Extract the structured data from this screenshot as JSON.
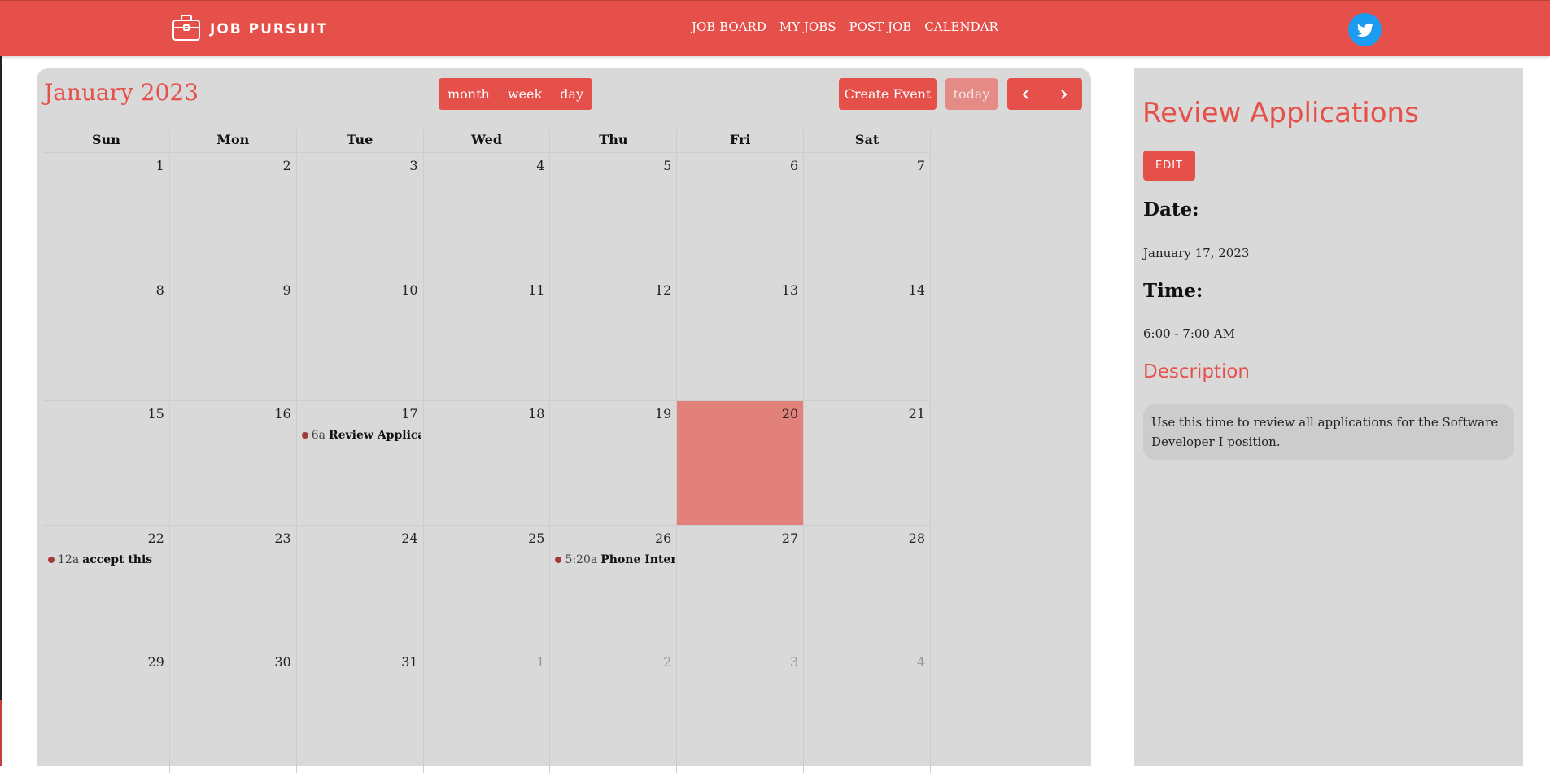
{
  "navbar": {
    "brand": "JOB PURSUIT",
    "links": [
      "JOB BOARD",
      "MY JOBS",
      "POST JOB",
      "CALENDAR"
    ],
    "social_icon": "twitter-icon",
    "brand_icon": "briefcase-icon",
    "accent_color": "#e5504a"
  },
  "calendar": {
    "title": "January 2023",
    "views": [
      "month",
      "week",
      "day"
    ],
    "create_label": "Create Event",
    "today_label": "today",
    "prev_icon": "chevron-left-icon",
    "next_icon": "chevron-right-icon",
    "weekdays": [
      "Sun",
      "Mon",
      "Tue",
      "Wed",
      "Thu",
      "Fri",
      "Sat"
    ],
    "weeks": [
      [
        {
          "n": "1"
        },
        {
          "n": "2"
        },
        {
          "n": "3"
        },
        {
          "n": "4"
        },
        {
          "n": "5"
        },
        {
          "n": "6"
        },
        {
          "n": "7"
        }
      ],
      [
        {
          "n": "8"
        },
        {
          "n": "9"
        },
        {
          "n": "10"
        },
        {
          "n": "11"
        },
        {
          "n": "12"
        },
        {
          "n": "13"
        },
        {
          "n": "14"
        }
      ],
      [
        {
          "n": "15"
        },
        {
          "n": "16"
        },
        {
          "n": "17",
          "event": {
            "time": "6a",
            "title": "Review Applications"
          }
        },
        {
          "n": "18"
        },
        {
          "n": "19"
        },
        {
          "n": "20",
          "today": true
        },
        {
          "n": "21"
        }
      ],
      [
        {
          "n": "22",
          "event": {
            "time": "12a",
            "title": "accept this"
          }
        },
        {
          "n": "23"
        },
        {
          "n": "24"
        },
        {
          "n": "25"
        },
        {
          "n": "26",
          "event": {
            "time": "5:20a",
            "title": "Phone Interview/D"
          }
        },
        {
          "n": "27"
        },
        {
          "n": "28"
        }
      ],
      [
        {
          "n": "29"
        },
        {
          "n": "30"
        },
        {
          "n": "31"
        },
        {
          "n": "1",
          "other": true
        },
        {
          "n": "2",
          "other": true
        },
        {
          "n": "3",
          "other": true
        },
        {
          "n": "4",
          "other": true
        }
      ]
    ]
  },
  "detail": {
    "title": "Review Applications",
    "edit_label": "EDIT",
    "date_label": "Date:",
    "date_value": "January 17, 2023",
    "time_label": "Time:",
    "time_value": "6:00 - 7:00 AM",
    "description_label": "Description",
    "description": "Use this time to review all applications for the Software Developer I position."
  }
}
